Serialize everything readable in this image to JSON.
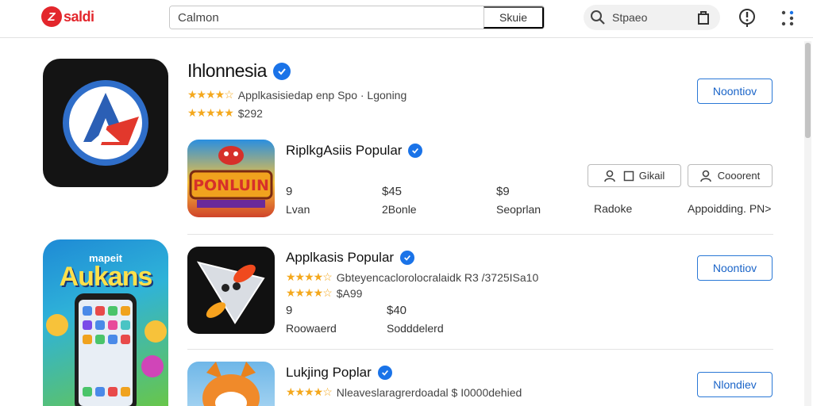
{
  "header": {
    "logo_mark": "Z",
    "logo_text": "saldi",
    "search_value": "Calmon",
    "search_button": "Skuie",
    "pill_label": "Stpaeo",
    "icons": [
      "search-icon",
      "bag-icon",
      "alert-icon",
      "menu-dots-icon"
    ]
  },
  "featured": {
    "title": "Ihlonnesia",
    "rating_stars": "★★★★☆",
    "line1": "Applkasisiedap enp Spo  ·  Lgoning",
    "rating_stars2": "★★★★★",
    "line2": "$292",
    "button": "Noontiov",
    "sub": {
      "title": "RiplkgAsiis Popular",
      "buttons": [
        "Gikail",
        "Cooorent"
      ],
      "stats": [
        {
          "value": "9",
          "label": "Lvan"
        },
        {
          "value": "$45",
          "label": "2Bonle"
        },
        {
          "value": "$9",
          "label": "Seoprlan"
        },
        {
          "value": "",
          "label": "Radoke"
        },
        {
          "value": "",
          "label": "Appoidding. PN>"
        }
      ]
    }
  },
  "list": [
    {
      "title": "Applkasis Popular",
      "stars": "★★★★☆",
      "line1": "Gbteyencaclorolocralaidk R3 /3725ISa10",
      "line2": "$A99",
      "button": "Noontiov",
      "stats": [
        {
          "value": "9",
          "label": "Roowaerd"
        },
        {
          "value": "$40",
          "label": "Sodddelerd"
        }
      ]
    },
    {
      "title": "Lukjing Poplar",
      "stars": "★★★★☆",
      "line1": "Nleaveslaragrerdoadal  $  I0000dehied",
      "button": "Nlondiev"
    }
  ],
  "promo_card": {
    "top_text": "mapeit",
    "big_text": "Aukans"
  },
  "colors": {
    "brand": "#e3262c",
    "accent": "#1a73e8",
    "stars": "#f4a81d"
  }
}
